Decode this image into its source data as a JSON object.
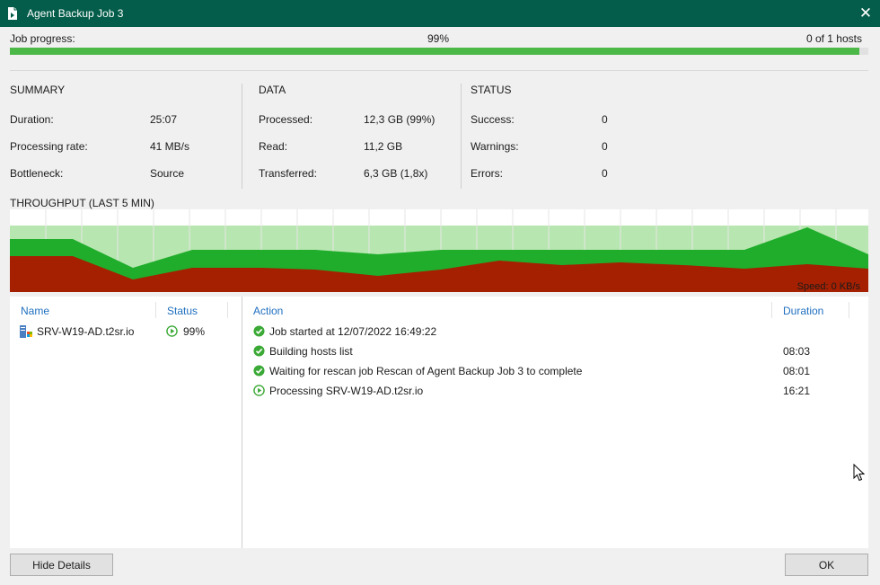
{
  "window": {
    "title": "Agent Backup Job 3",
    "close_glyph": "✕"
  },
  "progress": {
    "label": "Job progress:",
    "percent_text": "99%",
    "hosts_text": "0 of 1 hosts",
    "fraction": 0.99
  },
  "summary": {
    "title": "SUMMARY",
    "rows": [
      {
        "label": "Duration:",
        "value": "25:07"
      },
      {
        "label": "Processing rate:",
        "value": "41 MB/s"
      },
      {
        "label": "Bottleneck:",
        "value": "Source"
      }
    ]
  },
  "data_section": {
    "title": "DATA",
    "rows": [
      {
        "label": "Processed:",
        "value": "12,3 GB (99%)"
      },
      {
        "label": "Read:",
        "value": "11,2 GB"
      },
      {
        "label": "Transferred:",
        "value": "6,3 GB (1,8x)"
      }
    ]
  },
  "status_section": {
    "title": "STATUS",
    "rows": [
      {
        "label": "Success:",
        "value": "0"
      },
      {
        "label": "Warnings:",
        "value": "0"
      },
      {
        "label": "Errors:",
        "value": "0"
      }
    ]
  },
  "throughput": {
    "title": "THROUGHPUT (LAST 5 MIN)",
    "speed_text": "Speed: 0 KB/s",
    "colors": {
      "background": "#b8e6b0",
      "read": "#1fad2b",
      "transferred": "#a52000",
      "grid": "#ffffff"
    }
  },
  "hosts_table": {
    "columns": {
      "name": "Name",
      "status": "Status"
    },
    "rows": [
      {
        "name": "SRV-W19-AD.t2sr.io",
        "status": "99%"
      }
    ]
  },
  "actions_table": {
    "columns": {
      "action": "Action",
      "duration": "Duration"
    },
    "rows": [
      {
        "icon": "success-icon",
        "text": "Job started at 12/07/2022 16:49:22",
        "duration": ""
      },
      {
        "icon": "success-icon",
        "text": "Building hosts list",
        "duration": "08:03"
      },
      {
        "icon": "success-icon",
        "text": "Waiting for rescan job Rescan of Agent Backup Job 3 to complete",
        "duration": "08:01"
      },
      {
        "icon": "running-icon",
        "text": "Processing SRV-W19-AD.t2sr.io",
        "duration": "16:21"
      }
    ]
  },
  "buttons": {
    "hide_details": "Hide Details",
    "ok": "OK"
  },
  "colors": {
    "titlebar": "#045d4a",
    "progress_fill": "#4cb848",
    "link_blue": "#1f6fbf",
    "success_green": "#3aa935"
  }
}
